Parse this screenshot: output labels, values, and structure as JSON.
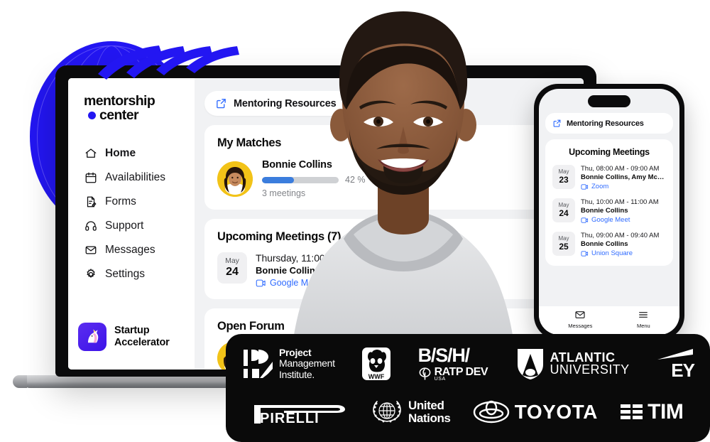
{
  "brand": {
    "line1": "mentorship",
    "line2": "center"
  },
  "sidebar": {
    "items": [
      {
        "label": "Home",
        "icon": "home-icon",
        "active": true
      },
      {
        "label": "Availabilities",
        "icon": "calendar-icon",
        "active": false
      },
      {
        "label": "Forms",
        "icon": "form-edit-icon",
        "active": false
      },
      {
        "label": "Support",
        "icon": "headset-icon",
        "active": false
      },
      {
        "label": "Messages",
        "icon": "envelope-icon",
        "active": false
      },
      {
        "label": "Settings",
        "icon": "gear-icon",
        "active": false
      }
    ],
    "workspace": {
      "line1": "Startup",
      "line2": "Accelerator",
      "icon": "unicorn-icon"
    }
  },
  "desktop": {
    "resources_button": "Mentoring Resources",
    "matches": {
      "title": "My Matches",
      "person": {
        "name": "Bonnie Collins",
        "progress_percent": 42,
        "progress_label": "42 %",
        "meetings_label": "3 meetings"
      }
    },
    "meetings": {
      "title": "Upcoming Meetings (7)",
      "items": [
        {
          "month": "May",
          "day": "24",
          "time": "Thursday, 11:00 AM - 12:00 PM",
          "who": "Bonnie Collins",
          "platform": "Google Meet"
        }
      ]
    },
    "open_section": {
      "title": "Open Forum"
    }
  },
  "phone": {
    "resources_button": "Mentoring Resources",
    "meetings": {
      "title": "Upcoming Meetings",
      "items": [
        {
          "month": "May",
          "day": "23",
          "time": "Thu, 08:00 AM - 09:00 AM",
          "who": "Bonnie Collins, Amy McFiel...",
          "platform": "Zoom"
        },
        {
          "month": "May",
          "day": "24",
          "time": "Thu, 10:00 AM - 11:00 AM",
          "who": "Bonnie Collins",
          "platform": "Google Meet"
        },
        {
          "month": "May",
          "day": "25",
          "time": "Thu, 09:00 AM - 09:40 AM",
          "who": "Bonnie Collins",
          "platform": "Union Square"
        }
      ]
    },
    "nav": [
      {
        "label": "Messages",
        "icon": "envelope-icon"
      },
      {
        "label": "Menu",
        "icon": "hamburger-icon"
      }
    ]
  },
  "logos": {
    "row1": [
      {
        "name": "Project Management Institute",
        "line1": "Project",
        "line2": "Management",
        "line3": "Institute."
      },
      {
        "name": "WWF",
        "text": "WWF"
      },
      {
        "name": "B/S/H",
        "text": "B/S/H/"
      },
      {
        "name": "RATP Dev USA",
        "text": "RATP DEV",
        "sub": "USA"
      },
      {
        "name": "Atlantic University",
        "line1": "ATLANTIC",
        "line2": "UNIVERSITY"
      },
      {
        "name": "EY",
        "text": "EY"
      }
    ],
    "row2": [
      {
        "name": "Pirelli",
        "text": "PIRELLI"
      },
      {
        "name": "United Nations",
        "line1": "United",
        "line2": "Nations"
      },
      {
        "name": "Toyota",
        "text": "TOYOTA"
      },
      {
        "name": "TIM",
        "text": "TIM"
      }
    ]
  },
  "colors": {
    "accent_blue": "#2316f2",
    "link_blue": "#2f6bff",
    "progress_blue": "#3b7ddd",
    "bar_black": "#0a0a0a",
    "app_bg": "#f1f2f4"
  }
}
